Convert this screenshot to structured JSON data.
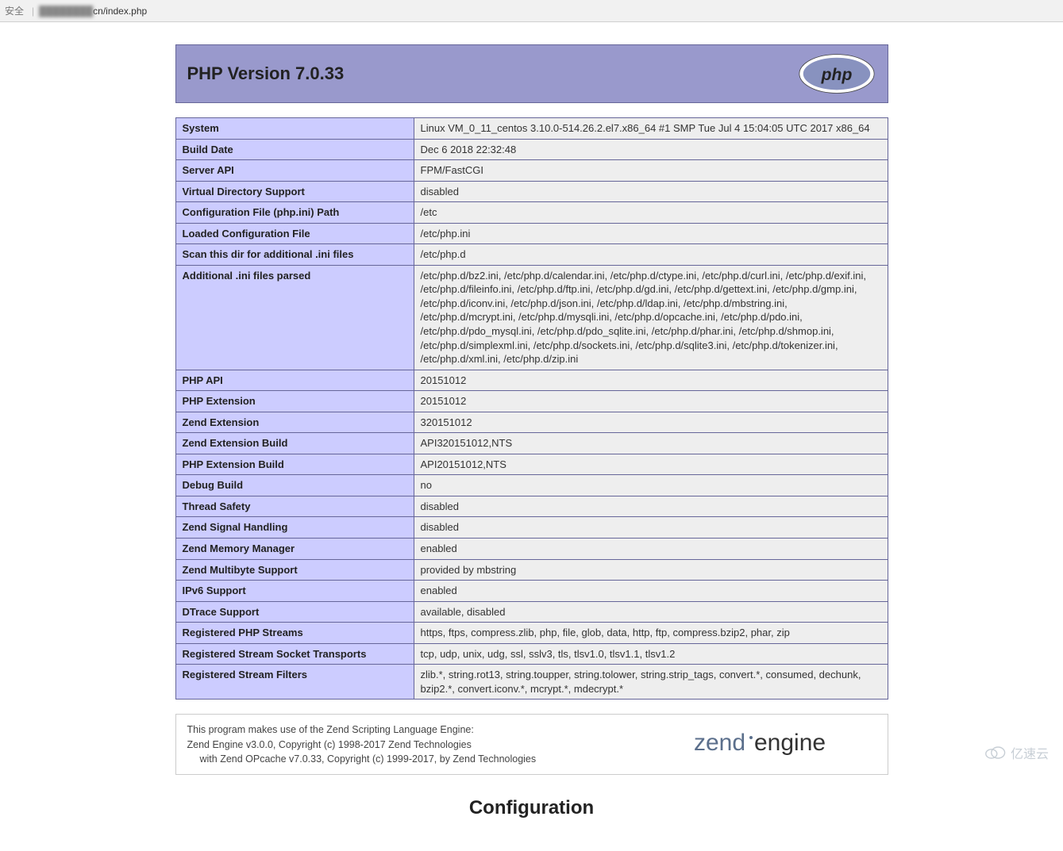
{
  "browser": {
    "security_label": "安全",
    "url_host_blur": "████████",
    "url_suffix": "cn/index.php"
  },
  "header": {
    "title": "PHP Version 7.0.33"
  },
  "rows": [
    {
      "label": "System",
      "value": "Linux VM_0_11_centos 3.10.0-514.26.2.el7.x86_64 #1 SMP Tue Jul 4 15:04:05 UTC 2017 x86_64"
    },
    {
      "label": "Build Date",
      "value": "Dec 6 2018 22:32:48"
    },
    {
      "label": "Server API",
      "value": "FPM/FastCGI"
    },
    {
      "label": "Virtual Directory Support",
      "value": "disabled"
    },
    {
      "label": "Configuration File (php.ini) Path",
      "value": "/etc"
    },
    {
      "label": "Loaded Configuration File",
      "value": "/etc/php.ini"
    },
    {
      "label": "Scan this dir for additional .ini files",
      "value": "/etc/php.d"
    },
    {
      "label": "Additional .ini files parsed",
      "value": "/etc/php.d/bz2.ini, /etc/php.d/calendar.ini, /etc/php.d/ctype.ini, /etc/php.d/curl.ini, /etc/php.d/exif.ini, /etc/php.d/fileinfo.ini, /etc/php.d/ftp.ini, /etc/php.d/gd.ini, /etc/php.d/gettext.ini, /etc/php.d/gmp.ini, /etc/php.d/iconv.ini, /etc/php.d/json.ini, /etc/php.d/ldap.ini, /etc/php.d/mbstring.ini, /etc/php.d/mcrypt.ini, /etc/php.d/mysqli.ini, /etc/php.d/opcache.ini, /etc/php.d/pdo.ini, /etc/php.d/pdo_mysql.ini, /etc/php.d/pdo_sqlite.ini, /etc/php.d/phar.ini, /etc/php.d/shmop.ini, /etc/php.d/simplexml.ini, /etc/php.d/sockets.ini, /etc/php.d/sqlite3.ini, /etc/php.d/tokenizer.ini, /etc/php.d/xml.ini, /etc/php.d/zip.ini"
    },
    {
      "label": "PHP API",
      "value": "20151012"
    },
    {
      "label": "PHP Extension",
      "value": "20151012"
    },
    {
      "label": "Zend Extension",
      "value": "320151012"
    },
    {
      "label": "Zend Extension Build",
      "value": "API320151012,NTS"
    },
    {
      "label": "PHP Extension Build",
      "value": "API20151012,NTS"
    },
    {
      "label": "Debug Build",
      "value": "no"
    },
    {
      "label": "Thread Safety",
      "value": "disabled"
    },
    {
      "label": "Zend Signal Handling",
      "value": "disabled"
    },
    {
      "label": "Zend Memory Manager",
      "value": "enabled"
    },
    {
      "label": "Zend Multibyte Support",
      "value": "provided by mbstring"
    },
    {
      "label": "IPv6 Support",
      "value": "enabled"
    },
    {
      "label": "DTrace Support",
      "value": "available, disabled"
    },
    {
      "label": "Registered PHP Streams",
      "value": "https, ftps, compress.zlib, php, file, glob, data, http, ftp, compress.bzip2, phar, zip"
    },
    {
      "label": "Registered Stream Socket Transports",
      "value": "tcp, udp, unix, udg, ssl, sslv3, tls, tlsv1.0, tlsv1.1, tlsv1.2"
    },
    {
      "label": "Registered Stream Filters",
      "value": "zlib.*, string.rot13, string.toupper, string.tolower, string.strip_tags, convert.*, consumed, dechunk, bzip2.*, convert.iconv.*, mcrypt.*, mdecrypt.*"
    }
  ],
  "zend": {
    "line1": "This program makes use of the Zend Scripting Language Engine:",
    "line2": "Zend Engine v3.0.0, Copyright (c) 1998-2017 Zend Technologies",
    "line3": "with Zend OPcache v7.0.33, Copyright (c) 1999-2017, by Zend Technologies"
  },
  "section_heading": "Configuration",
  "watermark": "亿速云"
}
